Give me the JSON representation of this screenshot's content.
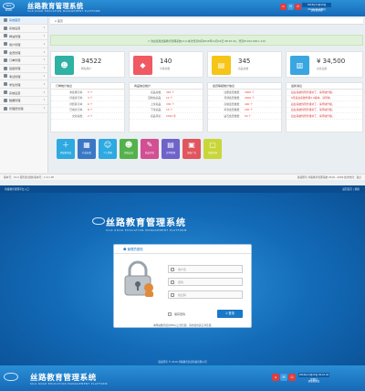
{
  "header": {
    "logo_text": "SILK ROAD",
    "title": "丝路教育管理系统",
    "subtitle": "SILK ROAD EDUCATION MANAGEMENT PLATFORM",
    "datetime": "2016年11月20日 09:10:44 星期日",
    "user": "超级管理员",
    "icons": [
      "home-icon",
      "mail-icon",
      "power-icon"
    ]
  },
  "sidebar": {
    "items": [
      {
        "label": "系统首页",
        "icon": "home-icon"
      },
      {
        "label": "系统设置",
        "icon": "gear-icon"
      },
      {
        "label": "网站管理",
        "icon": "globe-icon"
      },
      {
        "label": "用户管理",
        "icon": "user-icon"
      },
      {
        "label": "会员管理",
        "icon": "users-icon"
      },
      {
        "label": "订单管理",
        "icon": "cart-icon"
      },
      {
        "label": "班级管理",
        "icon": "book-icon"
      },
      {
        "label": "考试管理",
        "icon": "edit-icon"
      },
      {
        "label": "学生管理",
        "icon": "student-icon"
      },
      {
        "label": "系统设置",
        "icon": "settings-icon"
      },
      {
        "label": "数据管理",
        "icon": "database-icon"
      },
      {
        "label": "管理员管理",
        "icon": "admin-icon"
      }
    ]
  },
  "breadcrumb": "首页",
  "notice": "欢迎使用丝路教育管理系统v1.0,本次登录时间2016年11月21日 08:10:44，登录IP:192.168.1.110",
  "stats": [
    {
      "value": "34522",
      "label": "网站用户",
      "color": "#2fb1a3",
      "icon": "user-icon"
    },
    {
      "value": "140",
      "label": "分类总数",
      "color": "#ef5a63",
      "icon": "tag-icon"
    },
    {
      "value": "345",
      "label": "商品总数",
      "color": "#f5c518",
      "icon": "cart-icon"
    },
    {
      "value": "¥ 34,500",
      "label": "总营业额",
      "color": "#3aa6e1",
      "icon": "chart-icon"
    }
  ],
  "panels": {
    "orders": {
      "title": "订单统计信息",
      "rows": [
        {
          "k": "未处理订单：",
          "v": "5 个"
        },
        {
          "k": "待发货订单：",
          "v": "3 个"
        },
        {
          "k": "待结算订单：",
          "v": "6 个"
        },
        {
          "k": "已成交订单：",
          "v": "8 个"
        },
        {
          "k": "交易失败：",
          "v": "2 个"
        }
      ]
    },
    "goods": {
      "title": "商品信息统计",
      "rows": [
        {
          "k": "商品总数：",
          "v": "345 个"
        },
        {
          "k": "回收站商品：",
          "v": "12 个"
        },
        {
          "k": "上架商品：",
          "v": "330 个"
        },
        {
          "k": "下架商品：",
          "v": "15 个"
        },
        {
          "k": "商品评论：",
          "v": "2344 条"
        }
      ]
    },
    "members": {
      "title": "会员等级统计信息",
      "rows": [
        {
          "k": "注册会员数量：",
          "v": "3000 个"
        },
        {
          "k": "普通会员数量：",
          "v": "2400 个"
        },
        {
          "k": "高级会员数量：",
          "v": "400 个"
        },
        {
          "k": "黄金会员数量：",
          "v": "150 个"
        },
        {
          "k": "钻石会员数量：",
          "v": "50 个"
        }
      ]
    },
    "news": {
      "title": "最新消息",
      "rows": [
        "后台系统找到升级补丁，请尽快升级。",
        "6月后台系统升级2.0版本，请尽快。",
        "后台系统找到升级补丁，请尽快升级。",
        "后台系统找到升级补丁，请尽快升级。",
        "后台系统找到升级补丁，请尽快升级。"
      ]
    }
  },
  "quick": [
    {
      "label": "添加新商品",
      "color": "#2ea9e1",
      "icon": "plus-icon"
    },
    {
      "label": "产品分类",
      "color": "#3a78c6",
      "icon": "grid-icon"
    },
    {
      "label": "个人资料",
      "color": "#2ea9e1",
      "icon": "person-icon"
    },
    {
      "label": "添加会员",
      "color": "#55b14c",
      "icon": "user-plus-icon"
    },
    {
      "label": "商品评论",
      "color": "#d24f93",
      "icon": "comment-icon"
    },
    {
      "label": "订单管理",
      "color": "#6f63c9",
      "icon": "cart-icon"
    },
    {
      "label": "添加广告",
      "color": "#e1555e",
      "icon": "image-icon"
    },
    {
      "label": "添加文章",
      "color": "#c9d63a",
      "icon": "doc-icon"
    }
  ],
  "footer": {
    "left": "版本号：V1.0  服务器(当前)版本号：1.0.1.05",
    "right": "版权所有  丝路教育管理系统 2016 - 2099   技术支持：鑫点"
  },
  "login": {
    "topbar_left": "丝路教育管理平台入口",
    "topbar_right": "返回首页 | 帮助",
    "title": "管理员登陆",
    "username_ph": "用户名",
    "password_ph": "密码",
    "captcha_ph": "验证码",
    "remember": "保存密码",
    "button": "登录",
    "note": "本网站推荐使用IE8以上浏览器，请勿使用其它浏览器。",
    "copyright": "版权所有 ©  2016  丝路教育信息科技有限公司"
  }
}
